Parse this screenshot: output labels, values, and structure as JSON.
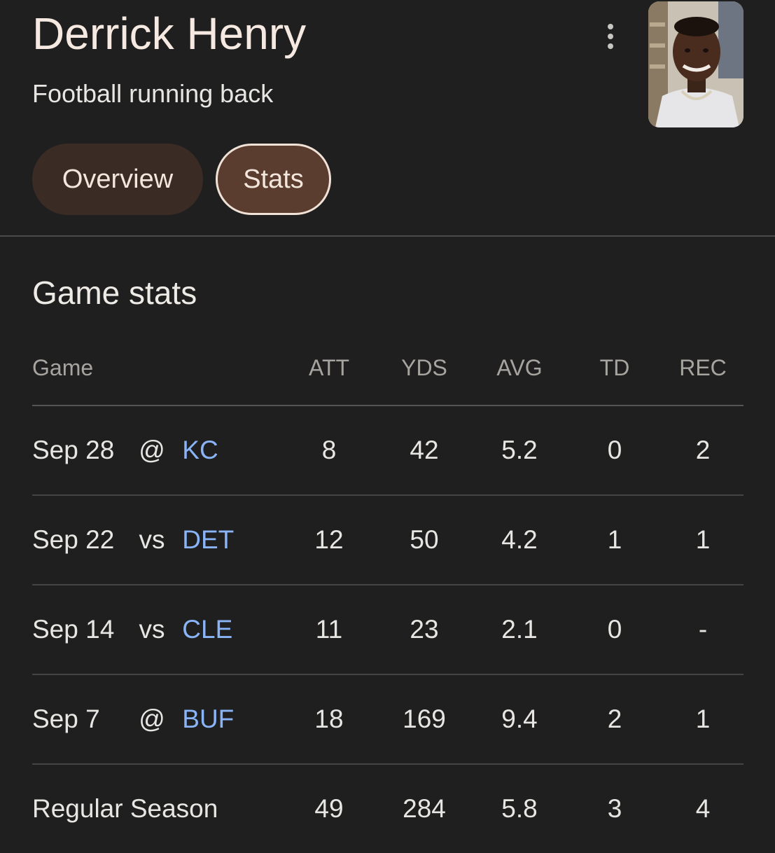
{
  "header": {
    "title": "Derrick Henry",
    "subtitle": "Football running back"
  },
  "tabs": [
    {
      "label": "Overview",
      "selected": false
    },
    {
      "label": "Stats",
      "selected": true
    }
  ],
  "section": {
    "title": "Game stats"
  },
  "table": {
    "columns": [
      "Game",
      "ATT",
      "YDS",
      "AVG",
      "TD",
      "REC"
    ],
    "rows": [
      {
        "date": "Sep 28",
        "venue": "@",
        "opponent": "KC",
        "att": "8",
        "yds": "42",
        "avg": "5.2",
        "td": "0",
        "rec": "2"
      },
      {
        "date": "Sep 22",
        "venue": "vs",
        "opponent": "DET",
        "att": "12",
        "yds": "50",
        "avg": "4.2",
        "td": "1",
        "rec": "1"
      },
      {
        "date": "Sep 14",
        "venue": "vs",
        "opponent": "CLE",
        "att": "11",
        "yds": "23",
        "avg": "2.1",
        "td": "0",
        "rec": "-"
      },
      {
        "date": "Sep 7",
        "venue": "@",
        "opponent": "BUF",
        "att": "18",
        "yds": "169",
        "avg": "9.4",
        "td": "2",
        "rec": "1"
      }
    ],
    "total": {
      "label": "Regular Season",
      "att": "49",
      "yds": "284",
      "avg": "5.8",
      "td": "3",
      "rec": "4"
    }
  },
  "colors": {
    "background": "#1f1f1f",
    "team_link": "#8ab4f8",
    "tab_selected": "#5a3d2f",
    "tab_default": "#3a2c24"
  }
}
